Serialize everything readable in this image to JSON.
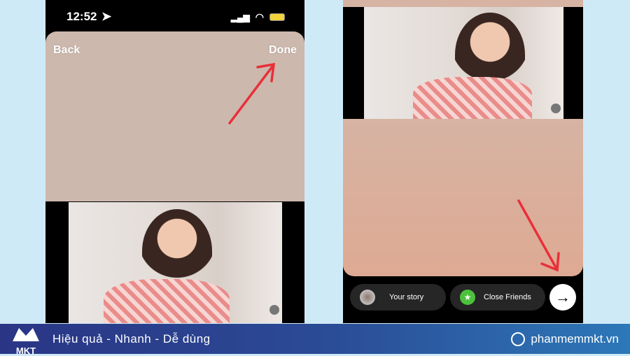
{
  "left_screen": {
    "status_time": "12:52",
    "back_label": "Back",
    "done_label": "Done"
  },
  "right_screen": {
    "your_story_label": "Your story",
    "close_friends_label": "Close Friends",
    "next_icon": "arrow-right-icon"
  },
  "footer": {
    "logo_text": "MKT",
    "slogan": "Hiệu quả - Nhanh - Dễ dùng",
    "website": "phanmemmkt.vn"
  },
  "colors": {
    "annotation_arrow": "#e8303a",
    "close_friends": "#4cc23c",
    "footer_start": "#2a3585",
    "footer_end": "#2c78b8"
  }
}
